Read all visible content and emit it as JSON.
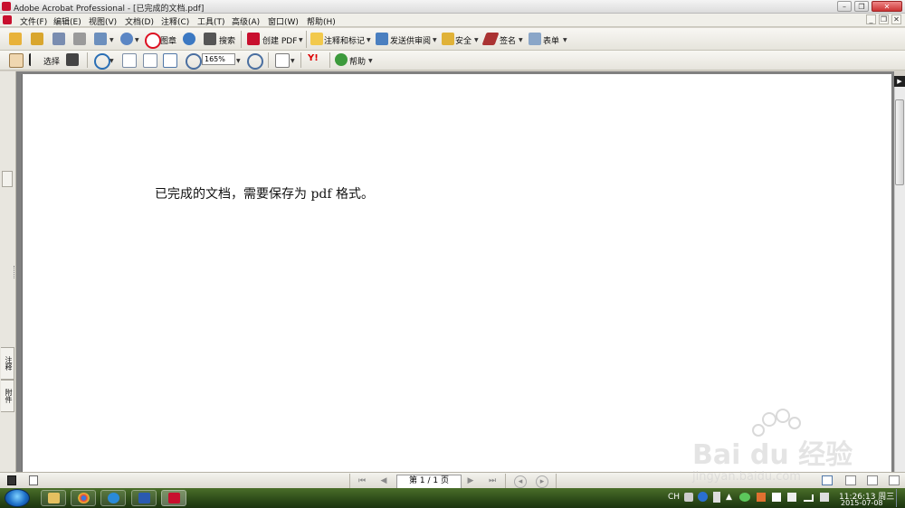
{
  "window": {
    "title": "Adobe Acrobat Professional - [已完成的文档.pdf]",
    "minimize": "–",
    "restore": "❐",
    "close": "✕"
  },
  "menu": {
    "items": [
      "文件(F)",
      "编辑(E)",
      "视图(V)",
      "文档(D)",
      "注释(C)",
      "工具(T)",
      "高级(A)",
      "窗口(W)",
      "帮助(H)"
    ],
    "doc_controls": [
      "_",
      "❐",
      "✕"
    ]
  },
  "toolbar1": {
    "stamp_label": "图章",
    "search_label": "搜索",
    "create_pdf_label": "创建 PDF",
    "comment_label": "注释和标记",
    "send_review_label": "发送供审阅",
    "secure_label": "安全",
    "sign_label": "签名",
    "forms_label": "表单"
  },
  "toolbar2": {
    "select_label": "选择",
    "zoom_value": "165%",
    "help_label": "帮助"
  },
  "nav_panel": {
    "tab1": "注释",
    "tab2": "附件"
  },
  "document": {
    "text": "已完成的文档，需要保存为 pdf 格式。"
  },
  "statusbar": {
    "page_indicator": "第 1 / 1 页"
  },
  "taskbar": {
    "language": "CH",
    "time": "11:26:13 周三",
    "date": "2015-07-08"
  },
  "watermark": {
    "brand": "Bai du 经验",
    "url": "jingyan.baidu.com"
  },
  "colors": {
    "acrobat_red": "#c8102e",
    "taskbar_green": "#2c4a18",
    "doc_gray": "#808080"
  }
}
